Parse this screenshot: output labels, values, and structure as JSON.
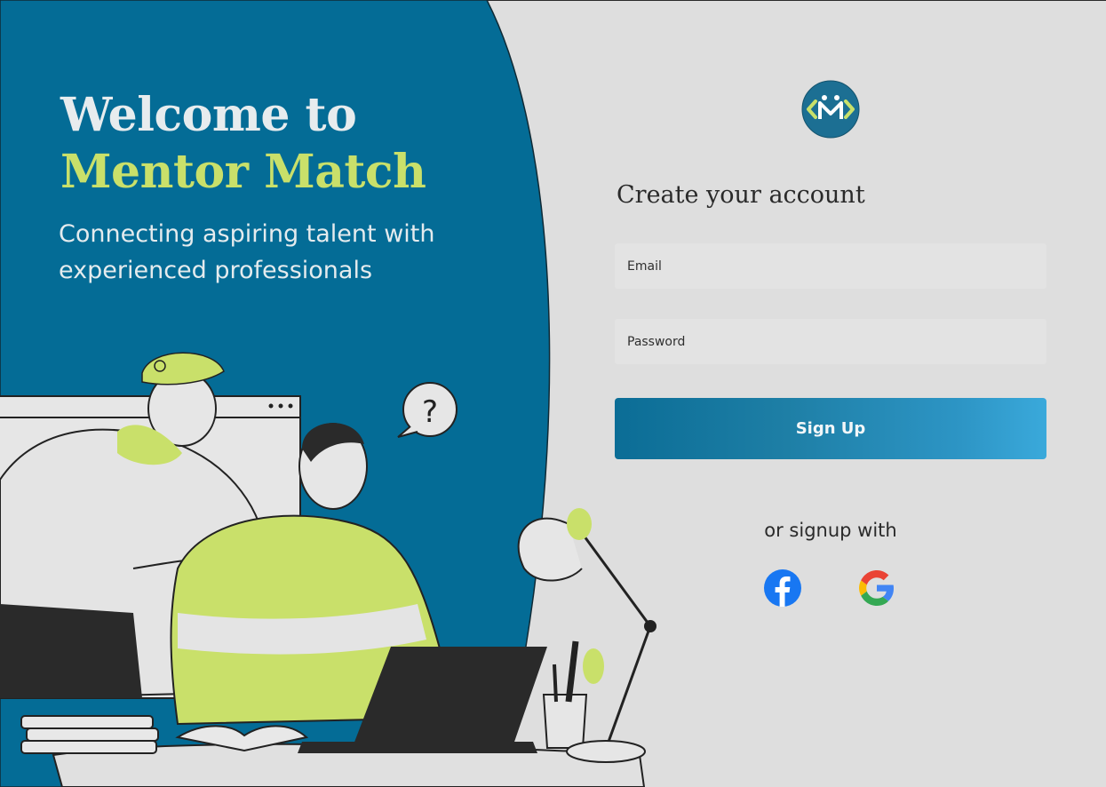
{
  "hero": {
    "title_line1": "Welcome to",
    "title_line2": "Mentor Match",
    "subtitle": "Connecting aspiring talent with experienced professionals"
  },
  "form": {
    "title": "Create your account",
    "email_placeholder": "Email",
    "password_placeholder": "Password",
    "submit_label": "Sign Up",
    "social_prompt": "or signup with",
    "social_providers": [
      "facebook-icon",
      "google-icon"
    ]
  },
  "colors": {
    "hero_blue": "#046c96",
    "accent_lime": "#c9e06a",
    "panel_bg": "#dedede",
    "button_gradient_start": "#0b6d96",
    "button_gradient_end": "#3aa9db",
    "facebook_blue": "#1877f2"
  },
  "logo_icon": "mentor-match-logo-icon"
}
